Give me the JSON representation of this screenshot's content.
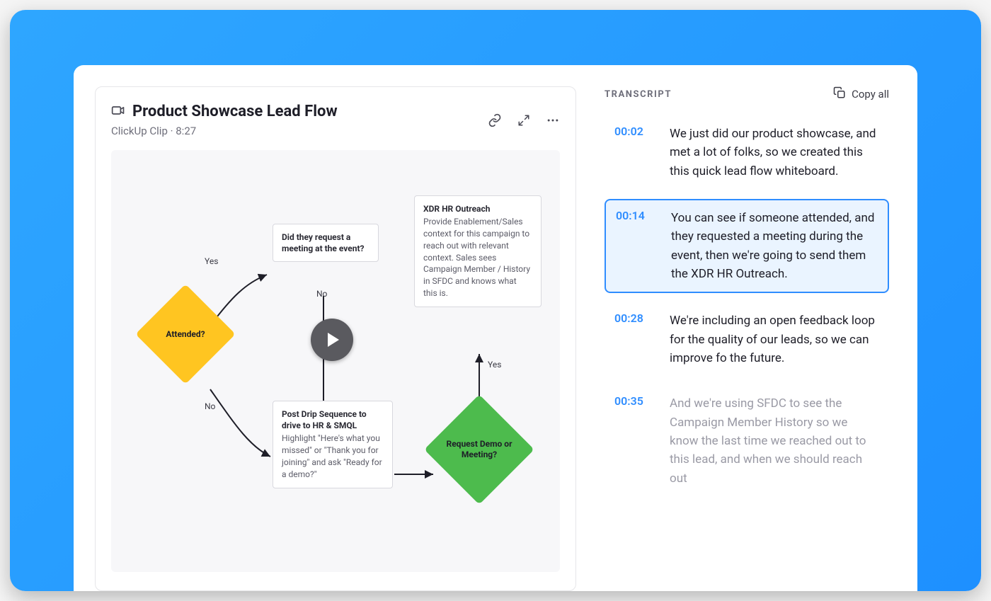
{
  "video": {
    "title": "Product Showcase Lead Flow",
    "source": "ClickUp Clip",
    "duration": "8:27"
  },
  "flowchart": {
    "attended_label": "Attended?",
    "edge_yes_top": "Yes",
    "edge_no_bottom": "No",
    "edge_no_mid": "No",
    "edge_yes_right": "Yes",
    "box_request_meeting": "Did they request a meeting at the event?",
    "box_xdr_title": "XDR HR Outreach",
    "box_xdr_body": "Provide Enablement/Sales context for this campaign to reach out with relevant context. Sales sees Campaign Member / History in SFDC and knows what this is.",
    "box_drip_title": "Post Drip Sequence to drive to HR & SMQL",
    "box_drip_body": "Highlight \"Here's what you missed\" or \"Thank you for joining\" and ask \"Ready for a demo?\"",
    "diamond_demo": "Request Demo or Meeting?"
  },
  "transcript": {
    "heading": "TRANSCRIPT",
    "copy_all_label": "Copy all",
    "items": [
      {
        "time": "00:02",
        "text": "We just did our product showcase, and met a lot of folks, so we created this this quick lead flow whiteboard."
      },
      {
        "time": "00:14",
        "text": "You can see if someone attended, and they requested a meeting during the event, then we're going to send them the XDR HR Outreach."
      },
      {
        "time": "00:28",
        "text": "We're including an open feedback loop for the quality of our leads, so we can improve fo the future."
      },
      {
        "time": "00:35",
        "text": "And we're using SFDC to see the Campaign Member History so we know the last time we reached out to this lead, and when we should reach out"
      }
    ]
  }
}
